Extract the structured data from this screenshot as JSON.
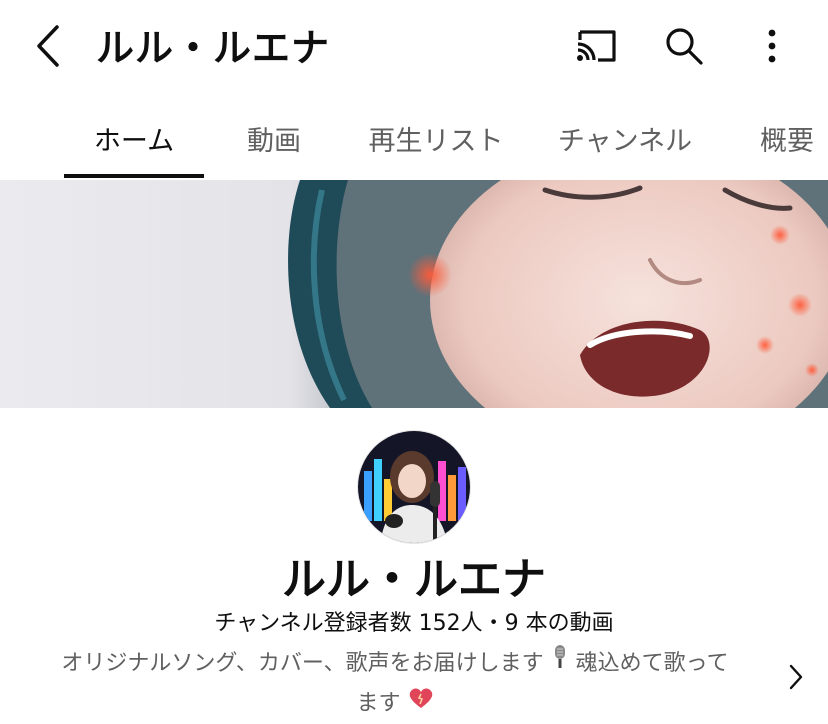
{
  "header": {
    "title": "ルル・ルエナ",
    "back_icon": "chevron-left-icon",
    "cast_icon": "cast-icon",
    "search_icon": "search-icon",
    "more_icon": "more-vert-icon"
  },
  "tabs": [
    {
      "label": "ホーム",
      "active": true
    },
    {
      "label": "動画",
      "active": false
    },
    {
      "label": "再生リスト",
      "active": false
    },
    {
      "label": "チャンネル",
      "active": false
    },
    {
      "label": "概要",
      "active": false
    }
  ],
  "channel": {
    "name": "ルル・ルエナ",
    "meta": "チャンネル登録者数 152人・9 本の動画",
    "description_line1": "オリジナルソング、カバー、歌声をお届けします",
    "description_emoji1": "microphone-icon",
    "description_line1_end": "魂込めて歌って",
    "description_line2": "ます",
    "description_emoji2": "heart-icon"
  },
  "colors": {
    "text_primary": "#0f0f0f",
    "text_secondary": "#606060",
    "tab_indicator": "#0f0f0f",
    "background": "#ffffff"
  }
}
